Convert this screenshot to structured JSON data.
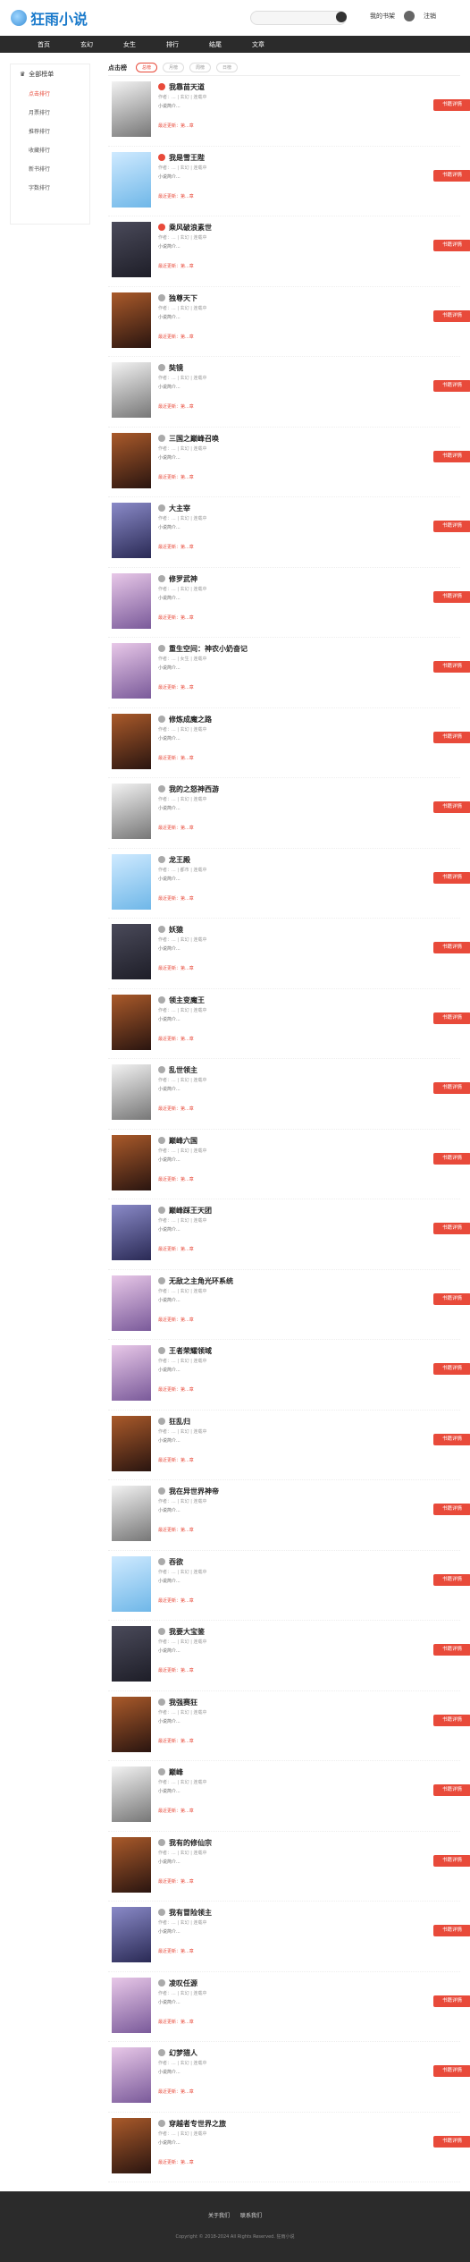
{
  "header": {
    "logo_text": "狂雨小说",
    "search_placeholder": "",
    "user_link": "我的书架",
    "logout_label": "注销"
  },
  "nav": [
    "首页",
    "玄幻",
    "女生",
    "排行",
    "结尾",
    "文章"
  ],
  "sidebar": {
    "title": "全部榜单",
    "items": [
      "点击排行",
      "月票排行",
      "推荐排行",
      "收藏排行",
      "新书排行",
      "字数排行"
    ]
  },
  "ranking": {
    "title": "点击榜",
    "tabs": [
      "总榜",
      "月榜",
      "周榜",
      "日榜"
    ]
  },
  "books": [
    {
      "title": "我靠苗天道",
      "meta": "作者：... | 玄幻 | 连载中",
      "desc": "小说简介...",
      "latest": "最近更新：第...章",
      "btn": "书籍详情"
    },
    {
      "title": "我是雪王陛",
      "meta": "作者：... | 玄幻 | 连载中",
      "desc": "小说简介...",
      "latest": "最近更新：第...章",
      "btn": "书籍详情"
    },
    {
      "title": "乘风破浪素世",
      "meta": "作者：... | 玄幻 | 连载中",
      "desc": "小说简介...",
      "latest": "最近更新：第...章",
      "btn": "书籍详情"
    },
    {
      "title": "独尊天下",
      "meta": "作者：... | 玄幻 | 连载中",
      "desc": "小说简介...",
      "latest": "最近更新：第...章",
      "btn": "书籍详情"
    },
    {
      "title": "奘镜",
      "meta": "作者：... | 玄幻 | 连载中",
      "desc": "小说简介...",
      "latest": "最近更新：第...章",
      "btn": "书籍详情"
    },
    {
      "title": "三国之巅峰召唤",
      "meta": "作者：... | 玄幻 | 连载中",
      "desc": "小说简介...",
      "latest": "最近更新：第...章",
      "btn": "书籍详情"
    },
    {
      "title": "大主宰",
      "meta": "作者：... | 玄幻 | 连载中",
      "desc": "小说简介...",
      "latest": "最近更新：第...章",
      "btn": "书籍详情"
    },
    {
      "title": "修罗武神",
      "meta": "作者：... | 玄幻 | 连载中",
      "desc": "小说简介...",
      "latest": "最近更新：第...章",
      "btn": "书籍详情"
    },
    {
      "title": "重生空间：神农小奶奋记",
      "meta": "作者：... | 女生 | 连载中",
      "desc": "小说简介...",
      "latest": "最近更新：第...章",
      "btn": "书籍详情"
    },
    {
      "title": "修炼成魔之路",
      "meta": "作者：... | 玄幻 | 连载中",
      "desc": "小说简介...",
      "latest": "最近更新：第...章",
      "btn": "书籍详情"
    },
    {
      "title": "我的之怒神西游",
      "meta": "作者：... | 玄幻 | 连载中",
      "desc": "小说简介...",
      "latest": "最近更新：第...章",
      "btn": "书籍详情"
    },
    {
      "title": "龙王殿",
      "meta": "作者：... | 都市 | 连载中",
      "desc": "小说简介...",
      "latest": "最近更新：第...章",
      "btn": "书籍详情"
    },
    {
      "title": "妖猿",
      "meta": "作者：... | 玄幻 | 连载中",
      "desc": "小说简介...",
      "latest": "最近更新：第...章",
      "btn": "书籍详情"
    },
    {
      "title": "领主变魔王",
      "meta": "作者：... | 玄幻 | 连载中",
      "desc": "小说简介...",
      "latest": "最近更新：第...章",
      "btn": "书籍详情"
    },
    {
      "title": "乱世领主",
      "meta": "作者：... | 玄幻 | 连载中",
      "desc": "小说简介...",
      "latest": "最近更新：第...章",
      "btn": "书籍详情"
    },
    {
      "title": "巅峰六国",
      "meta": "作者：... | 玄幻 | 连载中",
      "desc": "小说简介...",
      "latest": "最近更新：第...章",
      "btn": "书籍详情"
    },
    {
      "title": "巅峰踩王天团",
      "meta": "作者：... | 玄幻 | 连载中",
      "desc": "小说简介...",
      "latest": "最近更新：第...章",
      "btn": "书籍详情"
    },
    {
      "title": "无敌之主角光环系统",
      "meta": "作者：... | 玄幻 | 连载中",
      "desc": "小说简介...",
      "latest": "最近更新：第...章",
      "btn": "书籍详情"
    },
    {
      "title": "王者荣耀领域",
      "meta": "作者：... | 玄幻 | 连载中",
      "desc": "小说简介...",
      "latest": "最近更新：第...章",
      "btn": "书籍详情"
    },
    {
      "title": "狂乱归",
      "meta": "作者：... | 玄幻 | 连载中",
      "desc": "小说简介...",
      "latest": "最近更新：第...章",
      "btn": "书籍详情"
    },
    {
      "title": "我在异世界神帝",
      "meta": "作者：... | 玄幻 | 连载中",
      "desc": "小说简介...",
      "latest": "最近更新：第...章",
      "btn": "书籍详情"
    },
    {
      "title": "吞欲",
      "meta": "作者：... | 玄幻 | 连载中",
      "desc": "小说简介...",
      "latest": "最近更新：第...章",
      "btn": "书籍详情"
    },
    {
      "title": "我要大宝鉴",
      "meta": "作者：... | 玄幻 | 连载中",
      "desc": "小说简介...",
      "latest": "最近更新：第...章",
      "btn": "书籍详情"
    },
    {
      "title": "我强赛狂",
      "meta": "作者：... | 玄幻 | 连载中",
      "desc": "小说简介...",
      "latest": "最近更新：第...章",
      "btn": "书籍详情"
    },
    {
      "title": "巅峰",
      "meta": "作者：... | 玄幻 | 连载中",
      "desc": "小说简介...",
      "latest": "最近更新：第...章",
      "btn": "书籍详情"
    },
    {
      "title": "我有的修仙宗",
      "meta": "作者：... | 玄幻 | 连载中",
      "desc": "小说简介...",
      "latest": "最近更新：第...章",
      "btn": "书籍详情"
    },
    {
      "title": "我有冒险领主",
      "meta": "作者：... | 玄幻 | 连载中",
      "desc": "小说简介...",
      "latest": "最近更新：第...章",
      "btn": "书籍详情"
    },
    {
      "title": "凌叹任源",
      "meta": "作者：... | 玄幻 | 连载中",
      "desc": "小说简介...",
      "latest": "最近更新：第...章",
      "btn": "书籍详情"
    },
    {
      "title": "幻梦猎人",
      "meta": "作者：... | 玄幻 | 连载中",
      "desc": "小说简介...",
      "latest": "最近更新：第...章",
      "btn": "书籍详情"
    },
    {
      "title": "穿越者专世界之旅",
      "meta": "作者：... | 玄幻 | 连载中",
      "desc": "小说简介...",
      "latest": "最近更新：第...章",
      "btn": "书籍详情"
    }
  ],
  "footer": {
    "links": [
      "关于我们",
      "联系我们"
    ],
    "copyright": "Copyright © 2018-2024 All Rights Reserved. 狂雨小说"
  }
}
